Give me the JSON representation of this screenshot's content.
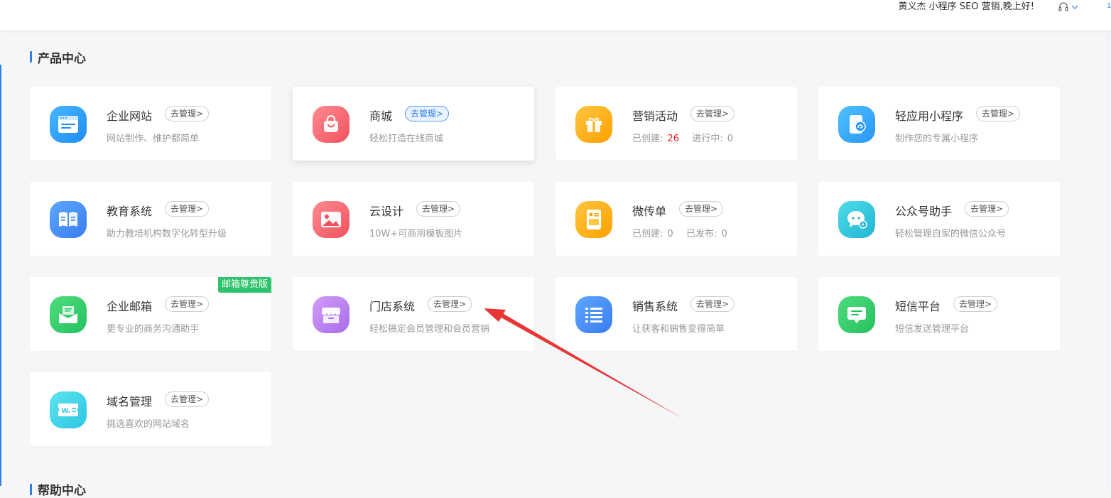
{
  "header": {
    "greeting": "黄义杰  小程序  SEO  营销,晚上好!",
    "edge_number": "1"
  },
  "section": {
    "title": "产品中心",
    "help_title": "帮助中心"
  },
  "colors": {
    "accent": "#2f80ed",
    "highlight_number": "#e02020",
    "badge_green": "#2dc26b",
    "annotation_arrow": "#e83535"
  },
  "cards": [
    {
      "title": "企业网站",
      "manage": "去管理>",
      "desc": "网站制作、维护都简单",
      "icon": "website-icon"
    },
    {
      "title": "商城",
      "manage": "去管理>",
      "desc": "轻松打造在线商城",
      "icon": "shopping-bag-icon"
    },
    {
      "title": "营销活动",
      "manage": "去管理>",
      "desc_created_label": "已创建:",
      "desc_created_value": "26",
      "desc_running_label": "进行中:",
      "desc_running_value": "0",
      "icon": "gift-icon"
    },
    {
      "title": "轻应用小程序",
      "manage": "去管理>",
      "desc": "制作您的专属小程序",
      "icon": "mini-program-icon"
    },
    {
      "title": "教育系统",
      "manage": "去管理>",
      "desc": "助力教培机构数字化转型升级",
      "icon": "open-book-icon"
    },
    {
      "title": "云设计",
      "manage": "去管理>",
      "desc": "10W+可商用模板图片",
      "icon": "image-icon"
    },
    {
      "title": "微传单",
      "manage": "去管理>",
      "desc_created_label": "已创建:",
      "desc_created_value": "0",
      "desc_published_label": "已发布:",
      "desc_published_value": "0",
      "icon": "flyer-icon"
    },
    {
      "title": "公众号助手",
      "manage": "去管理>",
      "desc": "轻松管理自家的微信公众号",
      "icon": "wechat-icon"
    },
    {
      "title": "企业邮箱",
      "manage": "去管理>",
      "desc": "更专业的商务沟通助手",
      "badge": "邮箱尊贵版",
      "icon": "mail-icon"
    },
    {
      "title": "门店系统",
      "manage": "去管理>",
      "desc": "轻松搞定会员管理和会员营销",
      "icon": "store-icon"
    },
    {
      "title": "销售系统",
      "manage": "去管理>",
      "desc": "让获客和销售变得简单",
      "icon": "list-icon"
    },
    {
      "title": "短信平台",
      "manage": "去管理>",
      "desc": "短信发送管理平台",
      "icon": "sms-icon"
    },
    {
      "title": "域名管理",
      "manage": "去管理>",
      "desc": "挑选喜欢的网站域名",
      "icon": "domain-icon"
    }
  ]
}
